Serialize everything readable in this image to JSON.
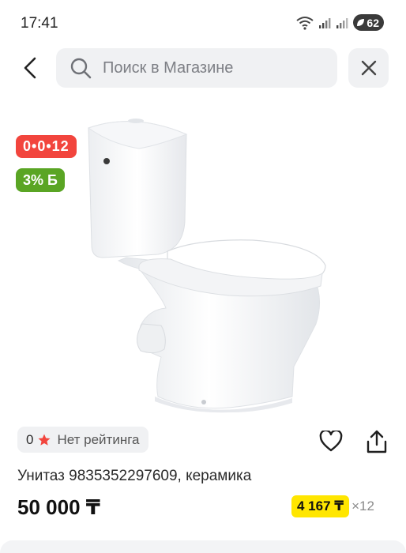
{
  "status_bar": {
    "time": "17:41",
    "battery": "62"
  },
  "search": {
    "placeholder": "Поиск в Магазине",
    "value": ""
  },
  "badges": {
    "timer": "0•0•12",
    "bonus": "3% Б"
  },
  "rating": {
    "count": "0",
    "label": "Нет рейтинга",
    "star_color": "#f2453d"
  },
  "product": {
    "title": "Унитаз 9835352297609, керамика",
    "price": "50 000 ₸",
    "installment_amount": "4 167 ₸",
    "installment_months": "×12"
  },
  "colors": {
    "timer_badge": "#f2453d",
    "bonus_badge": "#5aa524",
    "installment_badge": "#ffe600"
  },
  "icons": {
    "back": "arrow-left-icon",
    "search": "magnifier-icon",
    "clear": "close-icon",
    "favorite": "heart-icon",
    "share": "share-icon"
  }
}
